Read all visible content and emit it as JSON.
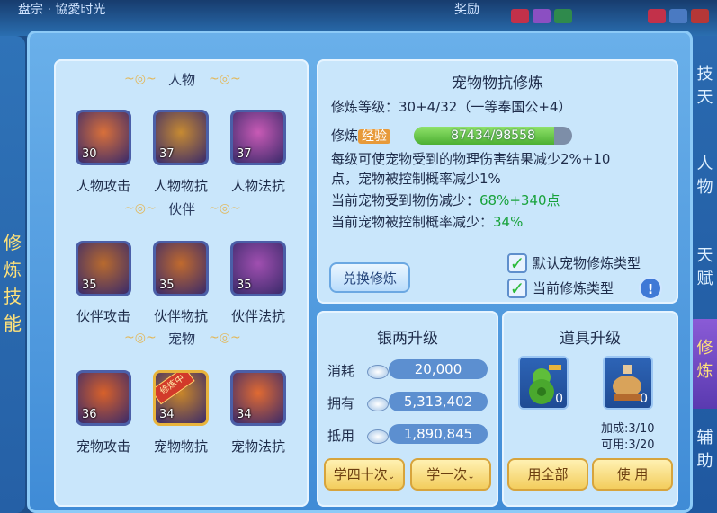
{
  "top_bar": {
    "left_text": "盘宗 · 協愛时光",
    "right_text": "奖励"
  },
  "left_tab": {
    "chars": [
      "修",
      "炼",
      "技",
      "能"
    ]
  },
  "right_tabs": [
    {
      "label": "技\n天"
    },
    {
      "label": "人\n物"
    },
    {
      "label": "天\n赋"
    },
    {
      "label": "修\n炼",
      "active": true
    },
    {
      "label": "辅\n助"
    }
  ],
  "categories": {
    "person": "人物",
    "partner": "伙伴",
    "pet": "宠物"
  },
  "skills": [
    {
      "name": "人物攻击",
      "level": "30",
      "color": "#d9703a"
    },
    {
      "name": "人物物抗",
      "level": "37",
      "color": "#c68a32"
    },
    {
      "name": "人物法抗",
      "level": "37",
      "color": "#c85ab5"
    },
    {
      "name": "伙伴攻击",
      "level": "35",
      "color": "#b86a2e"
    },
    {
      "name": "伙伴物抗",
      "level": "35",
      "color": "#c06a2e"
    },
    {
      "name": "伙伴法抗",
      "level": "35",
      "color": "#a04fb0"
    },
    {
      "name": "宠物攻击",
      "level": "36",
      "color": "#d8612a"
    },
    {
      "name": "宠物物抗",
      "level": "34",
      "color": "#c8862a",
      "badge": "修炼中"
    },
    {
      "name": "宠物法抗",
      "level": "34",
      "color": "#e06a32"
    }
  ],
  "detail": {
    "title": "宠物物抗修炼",
    "level_label": "修炼等级：",
    "level_value": "30+4/32（一等奉国公+4）",
    "exp_label": "修炼",
    "exp_tag": "经验",
    "exp_current": 87434,
    "exp_max": 98558,
    "exp_text": "87434/98558",
    "desc_line1": "每级可使宠物受到的物理伤害结果减少2%+10",
    "desc_line2": "点，宠物被控制概率减少1%",
    "current1_label": "当前宠物受到物伤减少：",
    "current1_value": "68%+340点",
    "current2_label": "当前宠物被控制概率减少：",
    "current2_value": "34%",
    "exchange_button": "兑换修炼",
    "check1": "默认宠物修炼类型",
    "check2": "当前修炼类型",
    "help": "!"
  },
  "silver": {
    "title": "银两升级",
    "consume_label": "消耗",
    "consume_value": "20,000",
    "have_label": "拥有",
    "have_value": "5,313,402",
    "deduct_label": "抵用",
    "deduct_value": "1,890,845",
    "btn40": "学四十次",
    "btn1": "学一次"
  },
  "items": {
    "title": "道具升级",
    "slot1_count": "0",
    "slot2_count": "0",
    "bonus": "加成:3/10",
    "usable": "可用:3/20",
    "use_all": "用全部",
    "use": "使 用"
  },
  "colors": {
    "green": "#18a23b",
    "panel": "#c9e6fb",
    "gold_button": "#f3cd5d"
  }
}
